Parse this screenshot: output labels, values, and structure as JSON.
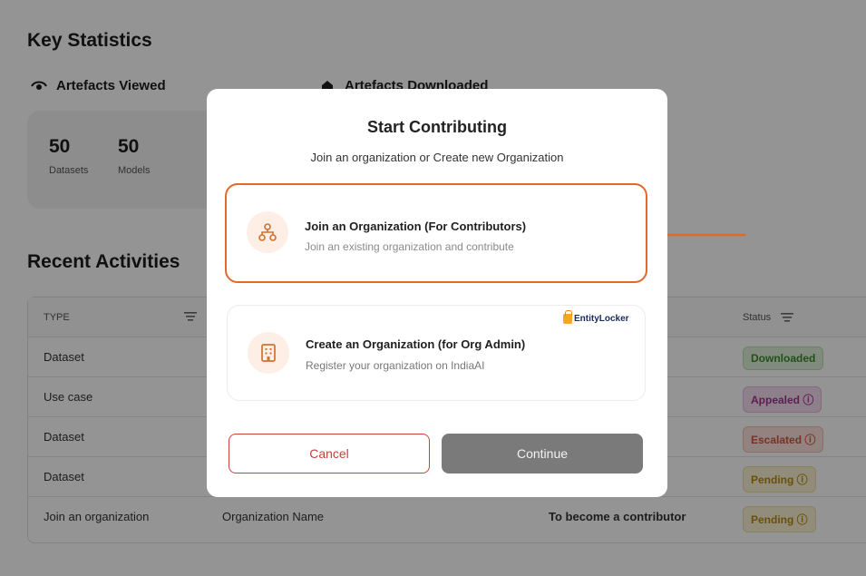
{
  "key_statistics": {
    "title": "Key Statistics",
    "artefacts_viewed_label": "Artefacts Viewed",
    "artefacts_downloaded_label": "Artefacts Downloaded",
    "stats": [
      {
        "value": "50",
        "label": "Datasets"
      },
      {
        "value": "50",
        "label": "Models"
      }
    ]
  },
  "recent_activities": {
    "title": "Recent Activities",
    "headers": {
      "type": "TYPE",
      "status": "Status"
    },
    "rows": [
      {
        "type": "Dataset",
        "name": "",
        "description": "",
        "status": "Downloaded",
        "status_kind": "downloaded"
      },
      {
        "type": "Use case",
        "name": "",
        "description": "",
        "status": "Appealed ⓘ",
        "status_kind": "appealed"
      },
      {
        "type": "Dataset",
        "name": "",
        "description": "",
        "status": "Escalated ⓘ",
        "status_kind": "escalated"
      },
      {
        "type": "Dataset",
        "name": "",
        "description": "",
        "status": "Pending ⓘ",
        "status_kind": "pending"
      },
      {
        "type": "Join an organization",
        "name": "Organization Name",
        "description": "To become a contributor",
        "status": "Pending ⓘ",
        "status_kind": "pending"
      }
    ]
  },
  "modal": {
    "title": "Start Contributing",
    "subtitle": "Join an organization or Create new Organization",
    "options": [
      {
        "title": "Join an Organization (For Contributors)",
        "description": "Join an existing organization and contribute",
        "selected": true
      },
      {
        "title": "Create an Organization (for Org Admin)",
        "description": "Register your organization on IndiaAI",
        "badge": "EntityLocker"
      }
    ],
    "cancel_label": "Cancel",
    "continue_label": "Continue"
  },
  "colors": {
    "accent": "#e06a2a",
    "cancel": "#c9403a",
    "continue_bg": "#7a7a7a"
  }
}
